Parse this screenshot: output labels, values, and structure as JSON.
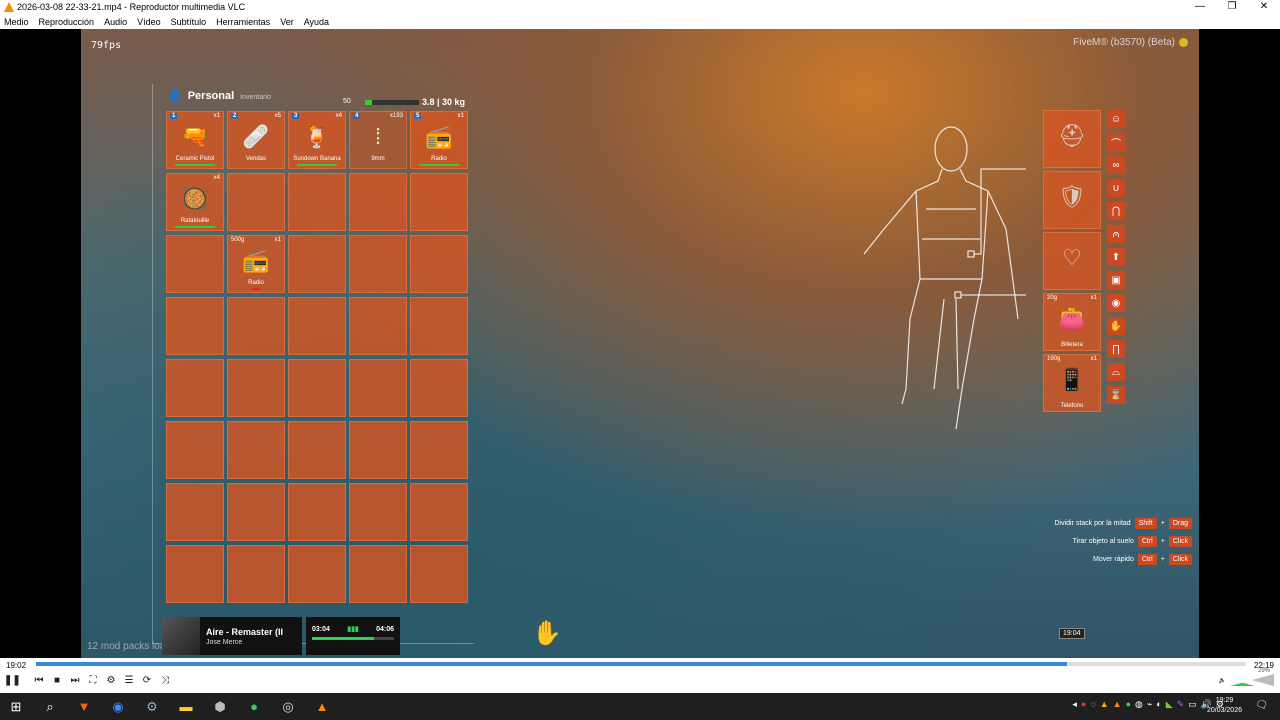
{
  "window": {
    "title": "2026-03-08 22-33-21.mp4 - Reproductor multimedia VLC",
    "min": "—",
    "max": "❐",
    "close": "✕"
  },
  "menu": [
    "Medio",
    "Reproducción",
    "Audio",
    "Vídeo",
    "Subtítulo",
    "Herramientas",
    "Ver",
    "Ayuda"
  ],
  "overlay": {
    "fps": "79fps",
    "fivem": "FiveM® (b3570) (Beta)",
    "mods": "12 mod packs loa"
  },
  "inventory": {
    "title": "Personal",
    "subtitle": "Inventario",
    "slots_count": "50",
    "weight": "3.8 | 30 kg",
    "weight_fraction": 0.127,
    "slots": [
      {
        "num": "1",
        "count": "x1",
        "label": "Ceramic Pistol",
        "icon": "pistol-icon",
        "glyph": "🔫",
        "durability": true
      },
      {
        "num": "2",
        "count": "x5",
        "label": "Vendas",
        "icon": "bandage-icon",
        "glyph": "🩹"
      },
      {
        "num": "3",
        "count": "x4",
        "label": "Sundown Banana",
        "icon": "cocktail-icon",
        "glyph": "🍹",
        "durability": true
      },
      {
        "num": "4",
        "count": "x193",
        "label": "9mm",
        "icon": "ammo-icon",
        "glyph": "⁞",
        "dim": true
      },
      {
        "num": "5",
        "count": "x1",
        "label": "Radio",
        "icon": "radio-icon",
        "glyph": "📻",
        "durability": true
      },
      {
        "count": "x4",
        "label": "Ratatouille",
        "icon": "food-icon",
        "glyph": "🥘",
        "durability": true
      },
      {},
      {},
      {},
      {},
      {},
      {
        "weight": "500g",
        "count": "x1",
        "label": "Radio",
        "icon": "radio-icon",
        "glyph": "📻",
        "durability_low": true
      },
      {},
      {},
      {},
      {},
      {},
      {},
      {},
      {},
      {},
      {},
      {},
      {},
      {},
      {},
      {},
      {},
      {},
      {},
      {},
      {},
      {},
      {},
      {},
      {},
      {},
      {},
      {},
      {}
    ]
  },
  "equipment": {
    "slots": [
      {
        "icon": "helmet-icon",
        "glyph": "⛑"
      },
      {
        "icon": "armor-icon",
        "glyph": "🛡"
      },
      {
        "icon": "necklace-icon",
        "glyph": "♡"
      },
      {
        "weight": "20g",
        "count": "x1",
        "label": "Billetera",
        "icon": "wallet-icon",
        "glyph": "👛"
      },
      {
        "weight": "190g",
        "count": "x1",
        "label": "Telefono",
        "icon": "phone-icon",
        "glyph": "📱"
      }
    ],
    "side_icons": [
      {
        "name": "mask-icon",
        "g": "☺"
      },
      {
        "name": "hat-icon",
        "g": "⌒"
      },
      {
        "name": "glasses-icon",
        "g": "∞"
      },
      {
        "name": "earring-icon",
        "g": "∪"
      },
      {
        "name": "jacket-icon",
        "g": "⋂"
      },
      {
        "name": "shirt-icon",
        "g": "⩀"
      },
      {
        "name": "arrow-up-icon",
        "g": "⬆"
      },
      {
        "name": "vest-icon",
        "g": "▣"
      },
      {
        "name": "watch-icon",
        "g": "◉"
      },
      {
        "name": "glove-icon",
        "g": "✋"
      },
      {
        "name": "pants-icon",
        "g": "∏"
      },
      {
        "name": "shoes-icon",
        "g": "⌓"
      },
      {
        "name": "hourglass-icon",
        "g": "⌛"
      }
    ]
  },
  "hints": [
    {
      "text": "Dividir stack por la mitad",
      "k1": "Shift",
      "k2": "Drag"
    },
    {
      "text": "Tirar objeto al suelo",
      "k1": "Ctrl",
      "k2": "Click"
    },
    {
      "text": "Mover rápido",
      "k1": "Ctrl",
      "k2": "Click"
    }
  ],
  "spotify": {
    "song": "Aire - Remaster (II",
    "artist": "Jose Merce",
    "elapsed": "03:04",
    "duration": "04:06",
    "progress": 0.75
  },
  "player": {
    "current": "19:02",
    "total": "22:19",
    "hover_time": "19:04",
    "progress": 0.852,
    "volume": "29%"
  },
  "taskbar": {
    "time": "19:29",
    "date": "20/03/2026"
  },
  "colors": {
    "slot": "#d65622",
    "accent": "#3a8ad8",
    "key": "#c94a22"
  }
}
